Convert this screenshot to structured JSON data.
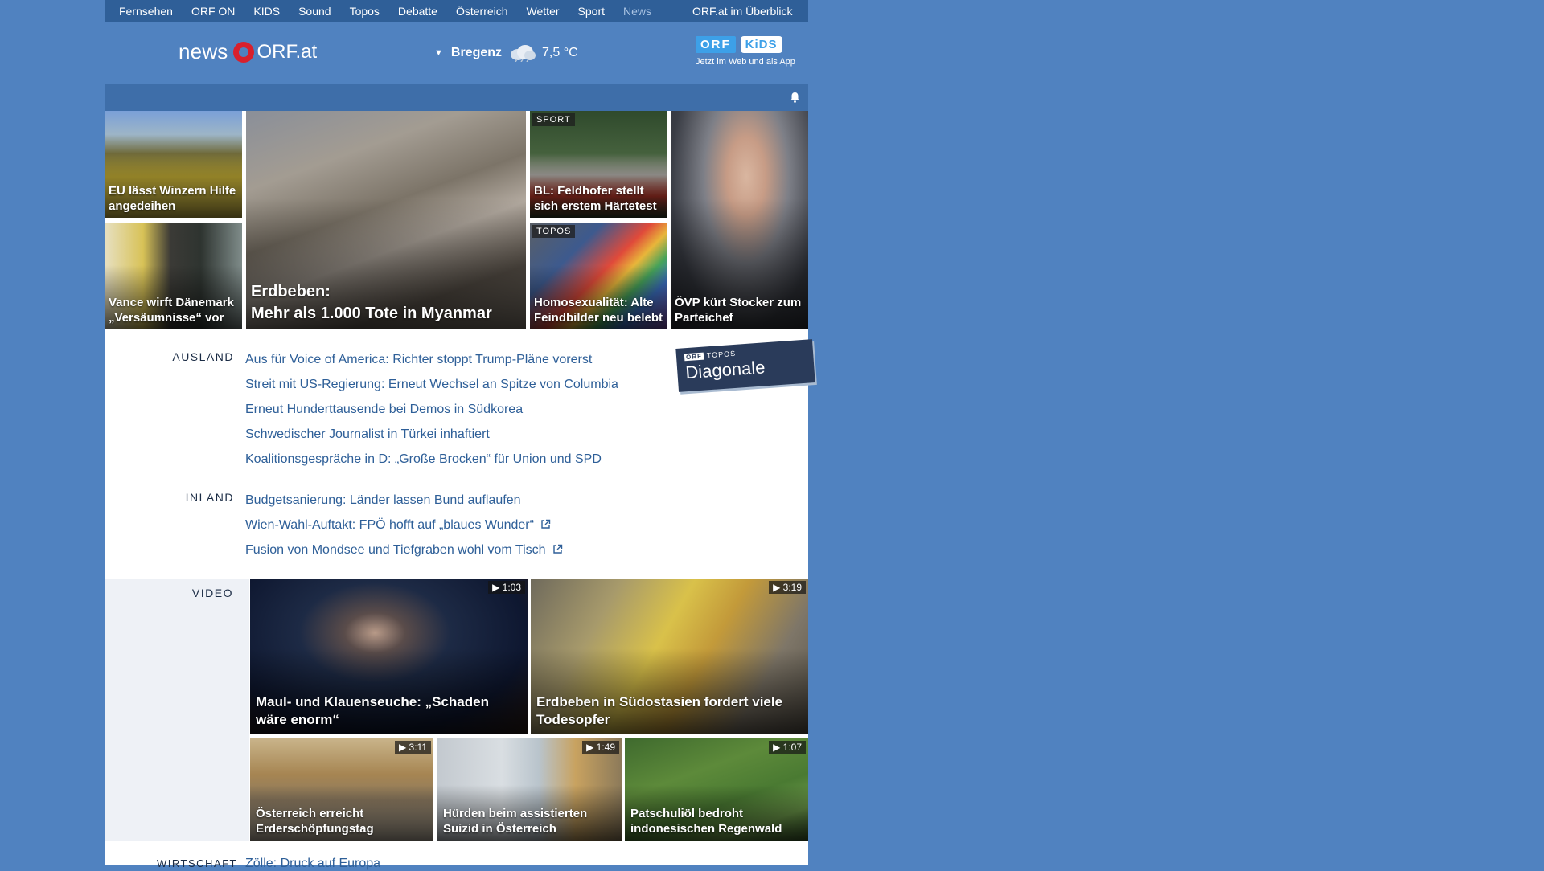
{
  "topnav": {
    "items": [
      "Fernsehen",
      "ORF ON",
      "KIDS",
      "Sound",
      "Topos",
      "Debatte",
      "Österreich",
      "Wetter",
      "Sport",
      "News"
    ],
    "active": "News",
    "overview": "ORF.at im Überblick"
  },
  "header": {
    "logo_news": "news",
    "logo_orfat": "ORF.at",
    "weather_city": "Bregenz",
    "weather_temp": "7,5 °C",
    "weather_icon": "cloud-rain-icon",
    "kids_orf": "ORF",
    "kids_label": "KiDS",
    "kids_tagline": "Jetzt im Web und als App"
  },
  "teasers": {
    "t1": {
      "caption": "EU lässt Winzern Hilfe angedeihen"
    },
    "t2": {
      "caption": "Vance wirft Dänemark „Versäumnisse“ vor"
    },
    "t3": {
      "caption_line1": "Erdbeben:",
      "caption_line2": "Mehr als 1.000 Tote in Myanmar"
    },
    "t4": {
      "tag": "SPORT",
      "caption": "BL: Feldhofer stellt sich erstem Härtetest"
    },
    "t5": {
      "tag": "TOPOS",
      "caption": "Homosexualität: Alte Feindbilder neu belebt"
    },
    "t6": {
      "caption": "ÖVP kürt Stocker zum Parteichef"
    }
  },
  "ausland": {
    "label": "AUSLAND",
    "items": [
      "Aus für Voice of America: Richter stoppt Trump-Pläne vorerst",
      "Streit mit US-Regierung: Erneut Wechsel an Spitze von Columbia",
      "Erneut Hunderttausende bei Demos in Südkorea",
      "Schwedischer Journalist in Türkei inhaftiert",
      "Koalitionsgespräche in D: „Große Brocken“ für Union und SPD"
    ]
  },
  "inland": {
    "label": "INLAND",
    "items": [
      "Budgetsanierung: Länder lassen Bund auflaufen",
      "Wien-Wahl-Auftakt: FPÖ hofft auf „blaues Wunder“",
      "Fusion von Mondsee und Tiefgraben wohl vom Tisch"
    ]
  },
  "diagonale": {
    "orf": "ORF",
    "topos": "TOPOS",
    "name": "Diagonale"
  },
  "video": {
    "label": "VIDEO",
    "v1": {
      "caption": "Maul- und Klauenseuche: „Schaden wäre enorm“",
      "duration": "1:03"
    },
    "v2": {
      "caption": "Erdbeben in Südostasien fordert viele Todesopfer",
      "duration": "3:19"
    },
    "v3": {
      "caption": "Österreich erreicht Erderschöpfungstag",
      "duration": "3:11"
    },
    "v4": {
      "caption": "Hürden beim assistierten Suizid in Österreich",
      "duration": "1:49"
    },
    "v5": {
      "caption": "Patschuliöl bedroht indonesischen Regenwald",
      "duration": "1:07"
    }
  },
  "bottom": {
    "label": "WIRTSCHAFT",
    "link": "Zölle: Druck auf Europa"
  }
}
